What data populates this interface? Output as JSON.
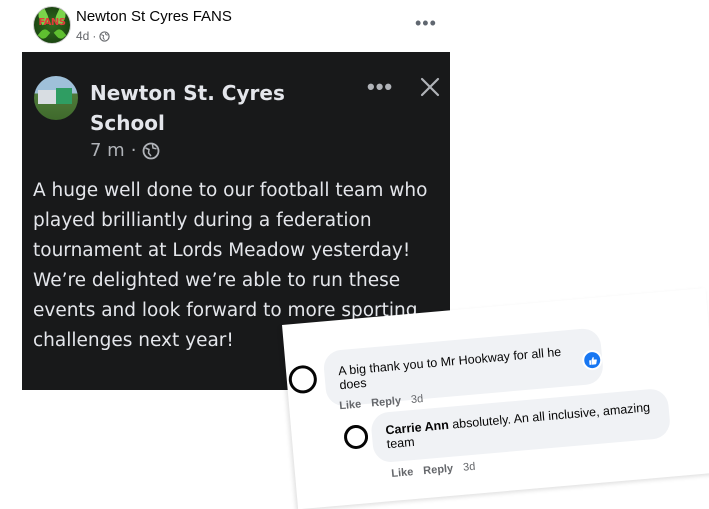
{
  "post": {
    "page_name": "Newton St Cyres FANS",
    "time": "4d",
    "more": "•••"
  },
  "avatar": {
    "logo_text": "FANS"
  },
  "shared": {
    "author": "Newton St. Cyres School",
    "time": "7 m",
    "more": "•••",
    "text": "A huge well done to our football team who played brilliantly during a federation tournament at Lords Meadow yesterday! We’re delighted we’re able to run these events and look forward to more sporting challenges next year!"
  },
  "comments": [
    {
      "author": "",
      "text": "A big thank you to Mr Hookway for all he does",
      "actions": {
        "like": "Like",
        "reply": "Reply",
        "time": "3d"
      },
      "reaction": "like-icon"
    },
    {
      "author": "Carrie Ann",
      "text": "absolutely. An all inclusive, amazing team",
      "actions": {
        "like": "Like",
        "reply": "Reply",
        "time": "3d"
      }
    }
  ],
  "colors": {
    "dark_bg": "#18191a",
    "dark_text": "#e4e6eb",
    "secondary": "#65676b",
    "like_blue": "#1877f2"
  }
}
